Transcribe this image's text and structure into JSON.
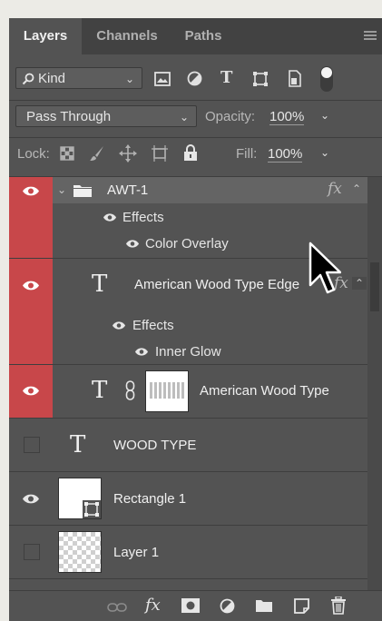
{
  "tabs": [
    {
      "label": "Layers",
      "active": true
    },
    {
      "label": "Channels",
      "active": false
    },
    {
      "label": "Paths",
      "active": false
    }
  ],
  "filter": {
    "kind_label": "Kind",
    "icons": [
      "image-filter-icon",
      "adjustment-filter-icon",
      "type-filter-icon",
      "shape-filter-icon",
      "smart-object-filter-icon",
      "filter-toggle"
    ]
  },
  "blend": {
    "mode": "Pass Through",
    "opacity_label": "Opacity:",
    "opacity_value": "100%"
  },
  "lock": {
    "label": "Lock:",
    "fill_label": "Fill:",
    "fill_value": "100%"
  },
  "layers": [
    {
      "name": "AWT-1",
      "type": "group",
      "visible": true,
      "effects_label": "Effects",
      "effects": [
        "Color Overlay"
      ],
      "fx": "fx"
    },
    {
      "name": "American Wood Type Edge",
      "type": "text",
      "visible": true,
      "effects_label": "Effects",
      "effects": [
        "Inner Glow"
      ],
      "fx": "fx"
    },
    {
      "name": "American Wood Type",
      "type": "text-linked",
      "visible": true
    },
    {
      "name": "WOOD TYPE",
      "type": "text",
      "visible": false
    },
    {
      "name": "Rectangle 1",
      "type": "shape",
      "visible": true
    },
    {
      "name": "Layer 1",
      "type": "pixel",
      "visible": false
    }
  ],
  "bottom_bar": [
    "link-layers-icon",
    "fx-icon",
    "mask-icon",
    "adjustment-icon",
    "group-folder-icon",
    "new-layer-icon",
    "trash-icon"
  ],
  "colors": {
    "visibility_highlight": "#c8474a",
    "panel_bg": "#535353",
    "selected_row": "#646464"
  }
}
